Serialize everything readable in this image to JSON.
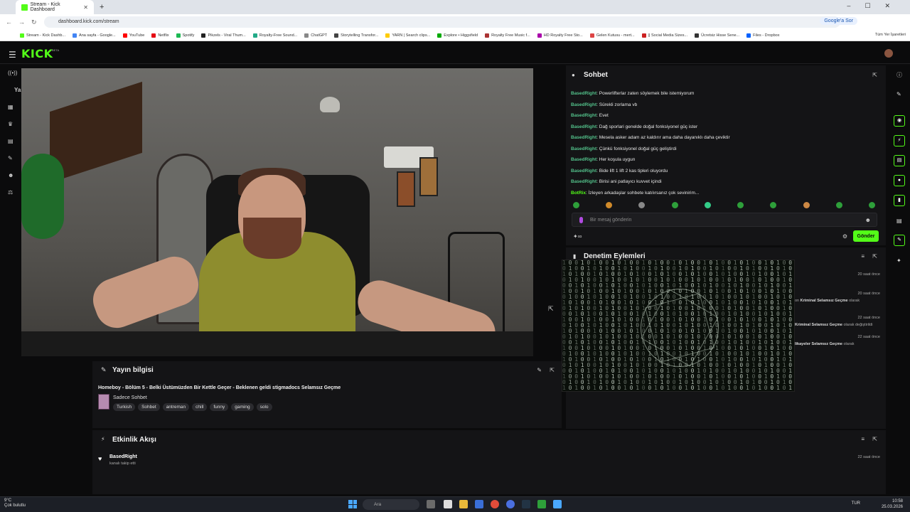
{
  "browser": {
    "tab_title": "Stream - Kick Dashboard",
    "url": "dashboard.kick.com/stream",
    "google_button": "Google'a Sor",
    "all_bookmarks": "Tüm Yer İşaretleri",
    "bookmarks": [
      "Stream - Kick Dashb...",
      "Ana sayfa - Google...",
      "YouTube",
      "Netflix",
      "Spotify",
      "Pikzels - Viral Thum...",
      "Royalty-Free Sound...",
      "ChatGPT",
      "Storytelling Transfor...",
      "YARN | Search clips...",
      "Explore • Higgsfield",
      "Royalty Free Music f...",
      "HD Royalty Free Sto...",
      "Gelen Kutusu - mert...",
      "|| Social Media Sizes...",
      "Ücretsiz Hisse Sene...",
      "Files - Dropbox"
    ]
  },
  "kick": {
    "logo": "KICK",
    "beta": "BETA"
  },
  "stream_info": {
    "panel_title": "Yayın bilgisi",
    "stream_title": "Homeboy - Bölüm 5 - Belki Üstümüzden Bir Kettle Geçer - Beklenen geldi stigmadocs Selamsız Geçme",
    "category": "Sadece Sohbet",
    "tags": [
      "Turkish",
      "Sohbet",
      "antreman",
      "chill",
      "funny",
      "gaming",
      "solo"
    ]
  },
  "activity": {
    "panel_title": "Etkinlik Akışı",
    "items": [
      {
        "user": "BasedRight",
        "text": "kanalı takip etti",
        "time": "22 saat önce"
      }
    ]
  },
  "chat": {
    "panel_title": "Sohbet",
    "messages": [
      {
        "user": "BasedRight",
        "text": "Powerlifterlar zaten söylemek bile istemiyorum"
      },
      {
        "user": "BasedRight",
        "text": "Sürekli zorlama vb"
      },
      {
        "user": "BasedRight",
        "text": "Evet"
      },
      {
        "user": "BasedRight",
        "text": "Dağ sporlari genelde doğal fonksiyonel güç ister"
      },
      {
        "user": "BasedRight",
        "text": "Mesela asker adam az kaldırır ama daha dayanıklı daha çeviktir"
      },
      {
        "user": "BasedRight",
        "text": "Çünkü fonksiyonel doğal güç geliştirdi"
      },
      {
        "user": "BasedRight",
        "text": "Her koşula uygun"
      },
      {
        "user": "BasedRight",
        "text": "Bide lift 1 lift 2 kas tipleri oluyordu"
      },
      {
        "user": "BasedRight",
        "text": "Birisi ani patlayıcı kuvvet içindi"
      },
      {
        "user": "BotRix",
        "text": "İzleyen arkadaşlar sohbete katılırsanız çok sevinirim..."
      }
    ],
    "input_placeholder": "Bir mesaj gönderin",
    "send_label": "Gönder"
  },
  "moderation": {
    "panel_title": "Denetim Eylemleri",
    "rows": [
      {
        "text_pre": "",
        "bold": "",
        "text_post": "",
        "time": "20 saat önce"
      },
      {
        "text_pre": "on ",
        "bold": "Kriminal Selamsız Geçme",
        "text_post": " olarak",
        "time": "20 saat önce"
      },
      {
        "text_pre": "",
        "bold": "Kriminal Selamsız Geçme",
        "text_post": " olarak değiştirildi",
        "time": "22 saat önce"
      },
      {
        "text_pre": "",
        "bold": "likayeler Selamsız Geçme",
        "text_post": " olarak",
        "time": "22 saat önce"
      }
    ]
  },
  "taskbar": {
    "weather_temp": "9°C",
    "weather_text": "Çok bulutlu",
    "search": "Ara",
    "lang": "TUR",
    "time": "10:58",
    "date": "25.03.2026"
  },
  "colors": {
    "accent": "#53fc18",
    "chat_username": "#53c28b",
    "panel_bg": "#141416",
    "page_bg": "#0b0b0c"
  }
}
